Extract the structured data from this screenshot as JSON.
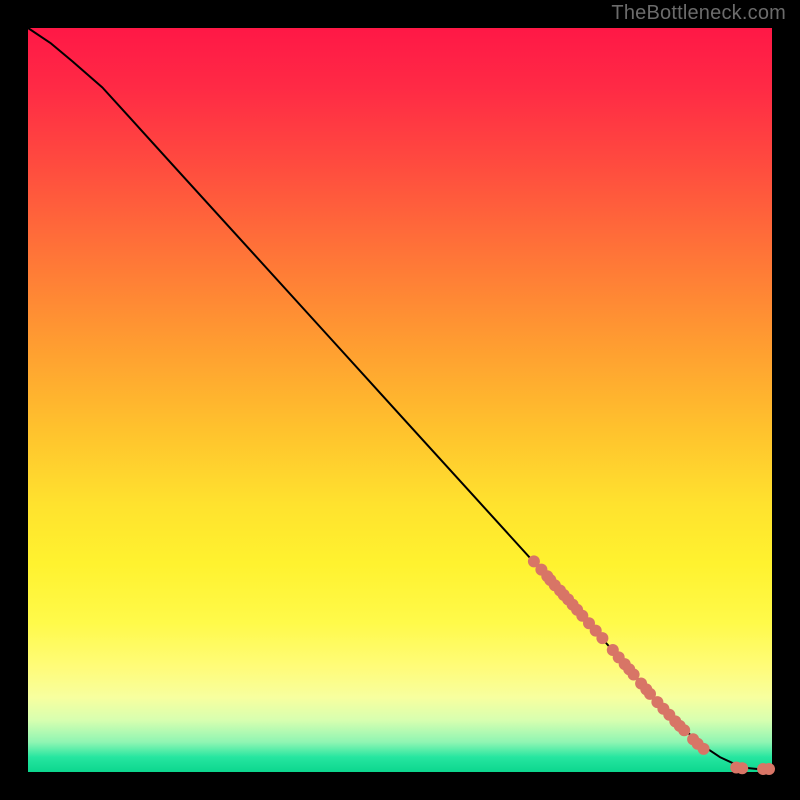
{
  "watermark": "TheBottleneck.com",
  "colors": {
    "frame_bg": "#000000",
    "curve": "#000000",
    "dot_fill": "#d87566"
  },
  "chart_data": {
    "type": "line",
    "title": "",
    "xlabel": "",
    "ylabel": "",
    "xlim": [
      0,
      100
    ],
    "ylim": [
      0,
      100
    ],
    "grid": false,
    "legend": false,
    "series": [
      {
        "name": "curve",
        "x": [
          0,
          3,
          6,
          10,
          15,
          20,
          30,
          40,
          50,
          60,
          70,
          78,
          85,
          90,
          93,
          96,
          98,
          100
        ],
        "y": [
          100,
          98,
          95.5,
          92,
          86.5,
          81,
          70,
          59,
          48,
          37,
          26,
          17,
          9,
          4,
          2,
          0.6,
          0.4,
          0.4
        ]
      }
    ],
    "points": [
      {
        "x": 68.0,
        "y": 28.3
      },
      {
        "x": 69.0,
        "y": 27.2
      },
      {
        "x": 69.8,
        "y": 26.3
      },
      {
        "x": 70.2,
        "y": 25.8
      },
      {
        "x": 70.8,
        "y": 25.1
      },
      {
        "x": 71.5,
        "y": 24.4
      },
      {
        "x": 72.0,
        "y": 23.8
      },
      {
        "x": 72.6,
        "y": 23.2
      },
      {
        "x": 73.2,
        "y": 22.5
      },
      {
        "x": 73.8,
        "y": 21.8
      },
      {
        "x": 74.5,
        "y": 21.0
      },
      {
        "x": 75.4,
        "y": 20.0
      },
      {
        "x": 76.3,
        "y": 19.0
      },
      {
        "x": 77.2,
        "y": 18.0
      },
      {
        "x": 78.6,
        "y": 16.4
      },
      {
        "x": 79.4,
        "y": 15.4
      },
      {
        "x": 80.2,
        "y": 14.5
      },
      {
        "x": 80.8,
        "y": 13.8
      },
      {
        "x": 81.4,
        "y": 13.1
      },
      {
        "x": 82.4,
        "y": 11.9
      },
      {
        "x": 83.1,
        "y": 11.1
      },
      {
        "x": 83.6,
        "y": 10.5
      },
      {
        "x": 84.6,
        "y": 9.4
      },
      {
        "x": 85.4,
        "y": 8.5
      },
      {
        "x": 86.2,
        "y": 7.7
      },
      {
        "x": 87.0,
        "y": 6.8
      },
      {
        "x": 87.6,
        "y": 6.2
      },
      {
        "x": 88.2,
        "y": 5.6
      },
      {
        "x": 89.4,
        "y": 4.4
      },
      {
        "x": 90.0,
        "y": 3.8
      },
      {
        "x": 90.8,
        "y": 3.1
      },
      {
        "x": 95.2,
        "y": 0.6
      },
      {
        "x": 96.0,
        "y": 0.5
      },
      {
        "x": 98.8,
        "y": 0.4
      },
      {
        "x": 99.6,
        "y": 0.4
      }
    ],
    "point_radius_px": 6
  }
}
